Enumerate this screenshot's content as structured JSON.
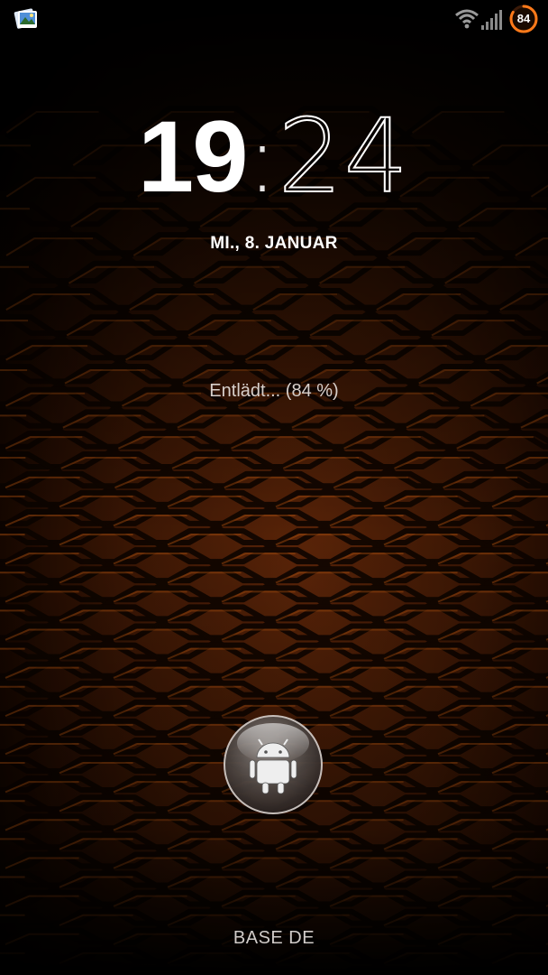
{
  "status_bar": {
    "notification_icon": "gallery-icon",
    "wifi_icon": "wifi-icon",
    "signal_icon": "signal-bars-icon",
    "battery_level": "84"
  },
  "clock": {
    "hour": "19",
    "separator": ":",
    "minute": "24"
  },
  "date": "MI., 8. JANUAR",
  "charging_status": "Entlädt... (84 %)",
  "unlock": {
    "icon": "android-icon"
  },
  "carrier": "BASE DE",
  "colors": {
    "accent": "#ff7a1a",
    "wallpaper_base": "#2a0f02",
    "text": "#ffffff"
  }
}
